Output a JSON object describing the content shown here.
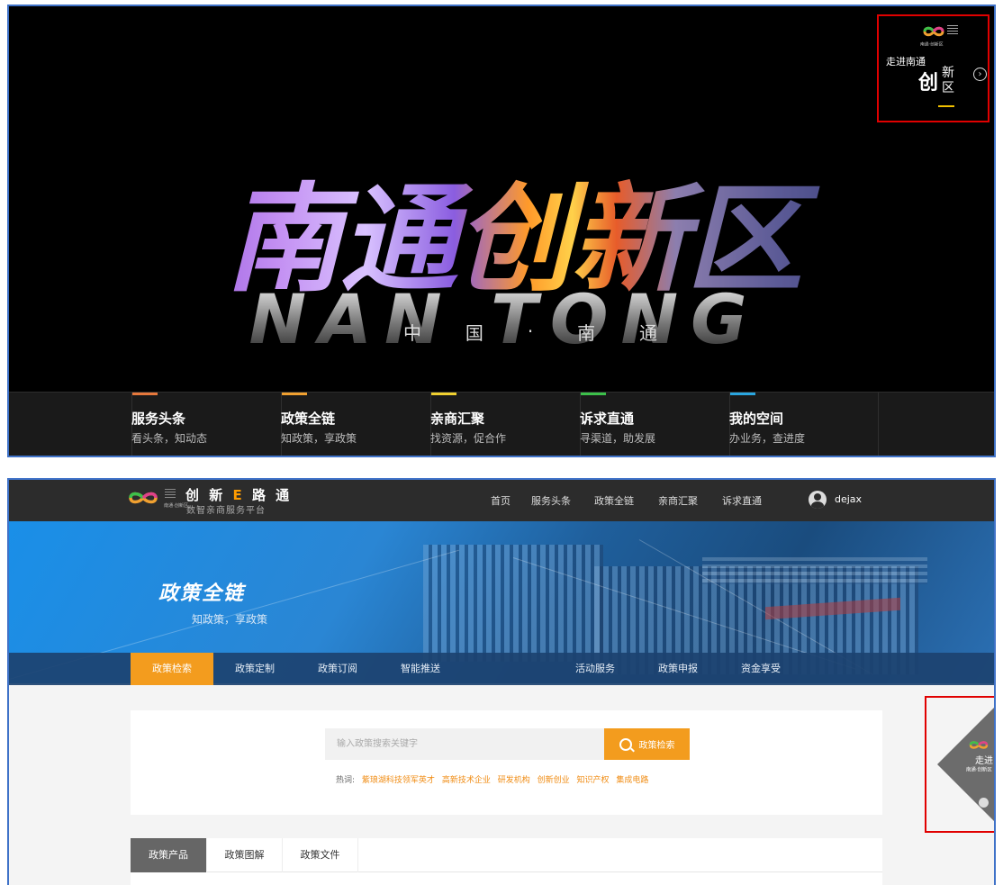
{
  "panel1": {
    "hero": {
      "title": "南通创新区",
      "subtitle": "NAN TONG",
      "cn_chars": [
        "中",
        "国",
        "·",
        "南",
        "通"
      ]
    },
    "widget": {
      "top_label": "走进南通",
      "big_char": "创",
      "small_chars": "新区",
      "tiny_logo_text": "南通·创新区"
    },
    "nav": [
      {
        "title": "服务头条",
        "subtitle": "看头条，知动态",
        "color": "#e6783c"
      },
      {
        "title": "政策全链",
        "subtitle": "知政策，享政策",
        "color": "#f0a030"
      },
      {
        "title": "亲商汇聚",
        "subtitle": "找资源，促合作",
        "color": "#f0d030"
      },
      {
        "title": "诉求直通",
        "subtitle": "寻渠道，助发展",
        "color": "#3cc04a"
      },
      {
        "title": "我的空间",
        "subtitle": "办业务，查进度",
        "color": "#2aa6e0"
      }
    ]
  },
  "panel2": {
    "header": {
      "logo_small_text": "南通·创新区",
      "brand_prefix": "创 新",
      "brand_e": "E",
      "brand_suffix": "路 通",
      "brand_sub": "数智亲商服务平台",
      "nav": [
        "首页",
        "服务头条",
        "政策全链",
        "亲商汇聚",
        "诉求直通"
      ],
      "user": "dejax"
    },
    "banner": {
      "title": "政策全链",
      "subtitle": "知政策，享政策"
    },
    "tabs": [
      "政策检索",
      "政策定制",
      "政策订阅",
      "智能推送",
      "活动服务",
      "政策申报",
      "资金享受"
    ],
    "active_tab": "政策检索",
    "search": {
      "placeholder": "输入政策搜索关键字",
      "button": "政策检索",
      "hot_label": "热词:",
      "hot_words": [
        "紫琅湖科技领军英才",
        "高新技术企业",
        "研发机构",
        "创新创业",
        "知识产权",
        "集成电路"
      ]
    },
    "doc_tabs": [
      "政策产品",
      "政策图解",
      "政策文件"
    ],
    "widget": {
      "title": "走进",
      "sub": "南通·创新区"
    },
    "colors": {
      "accent": "#f39c1e",
      "highlight_box": "#e00000"
    }
  }
}
